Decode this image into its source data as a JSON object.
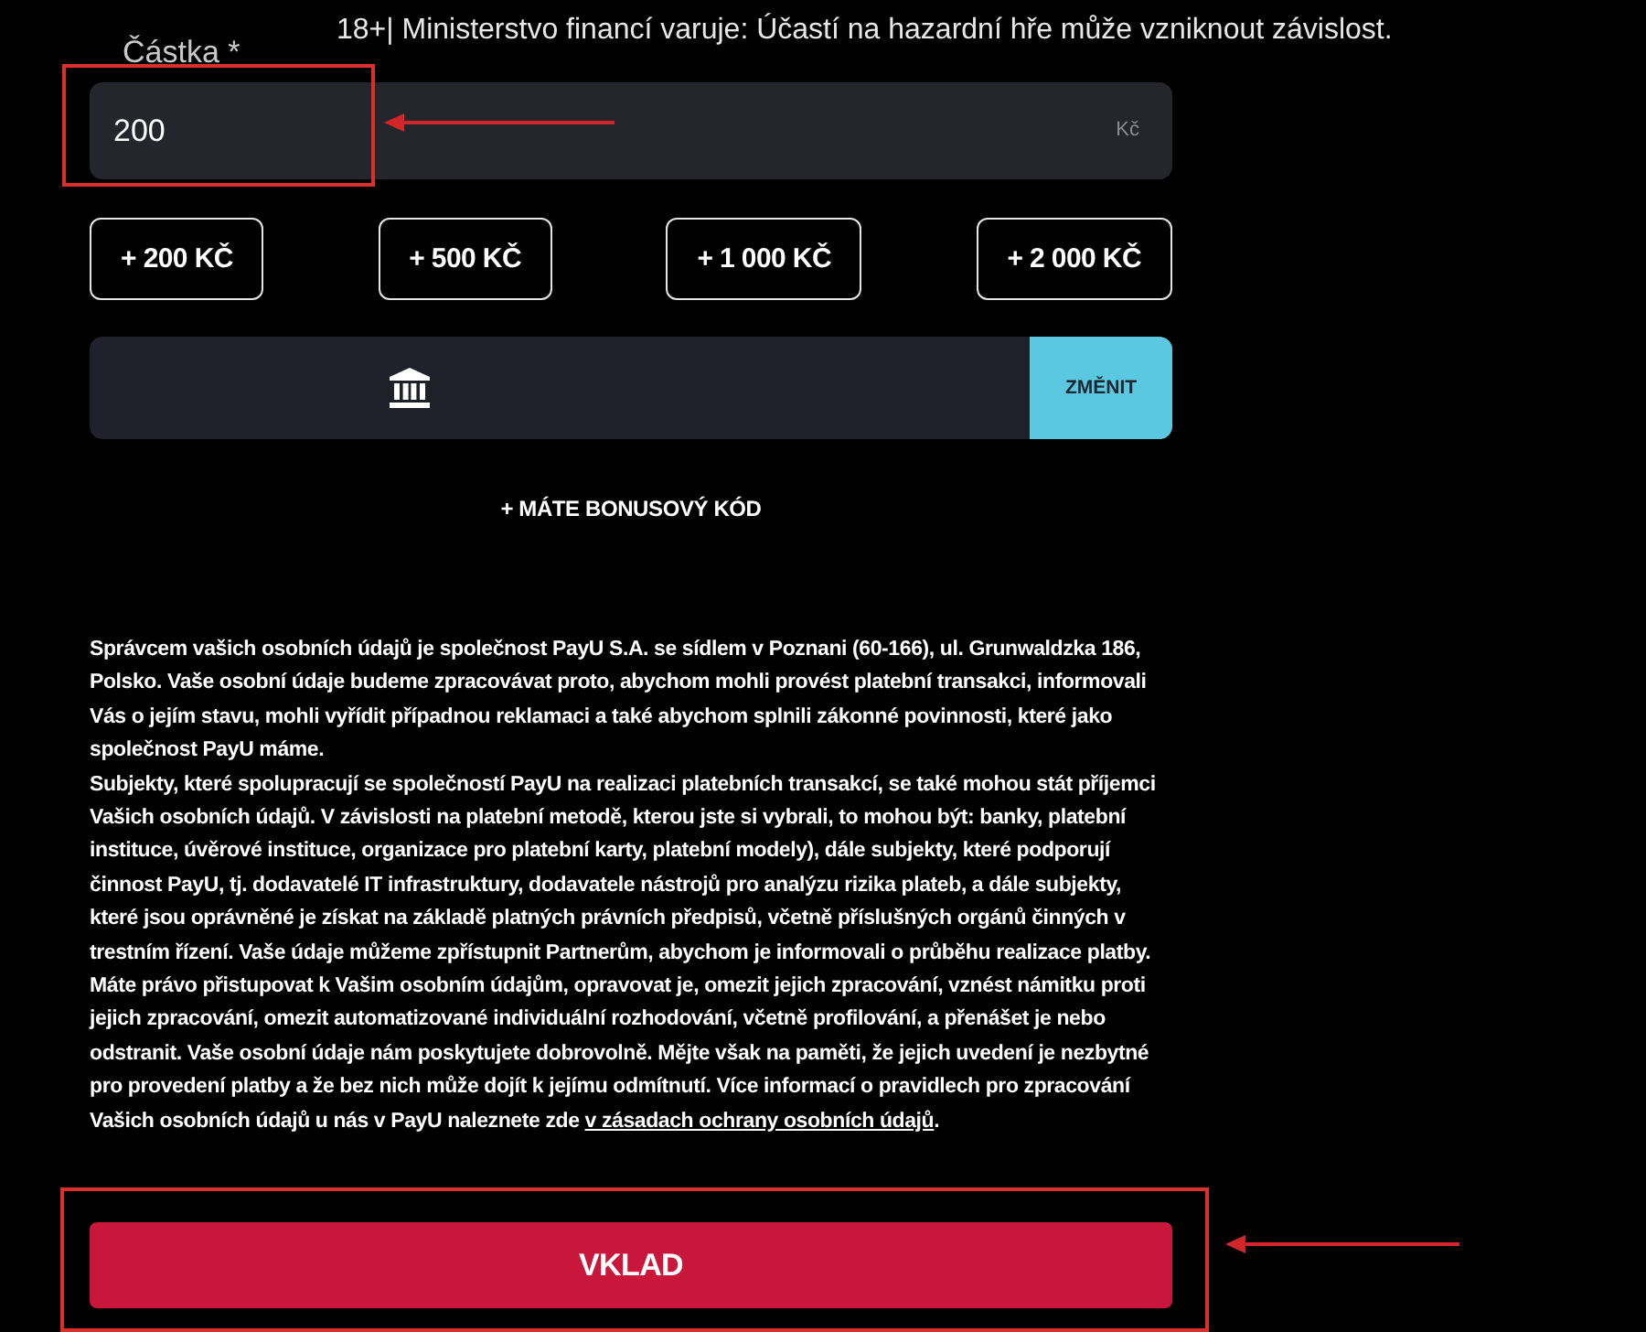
{
  "warning_banner": "18+| Ministerstvo financí varuje: Účastí na hazardní hře může vzniknout závislost.",
  "amount": {
    "label": "Částka *",
    "value": "200",
    "currency": "Kč"
  },
  "quick_amounts": [
    "+ 200 KČ",
    "+ 500 KČ",
    "+ 1 000 KČ",
    "+ 2 000 KČ"
  ],
  "payment_method": {
    "change_button": "ZMĚNIT"
  },
  "bonus_code_link": "+ MÁTE BONUSOVÝ KÓD",
  "privacy_notice": {
    "paragraphs": [
      {
        "text": "Správcem vašich osobních údajů je společnost PayU S.A. se sídlem v Poznani (60-166), ul. Grunwaldzka 186, Polsko. Vaše osobní údaje budeme zpracovávat proto, abychom mohli provést platební transakci, informovali Vás o jejím stavu, mohli vyřídit případnou reklamaci a také abychom splnili zákonné povinnosti, které jako společnost PayU máme."
      },
      {
        "text": "Subjekty, které spolupracují se společností PayU na realizaci platebních transakcí, se také mohou stát příjemci Vašich osobních údajů. V závislosti na platební metodě, kterou jste si vybrali, to mohou být: banky, platební instituce, úvěrové instituce, organizace pro platební karty, platební modely), dále subjekty, které podporují činnost PayU, tj. dodavatelé IT infrastruktury, dodavatele nástrojů pro analýzu rizika plateb, a dále subjekty, které jsou oprávněné je získat na základě platných právních předpisů, včetně příslušných orgánů činných v trestním řízení. Vaše údaje můžeme zpřístupnit Partnerům, abychom je informovali o průběhu realizace platby."
      },
      {
        "text": "Máte právo přistupovat k Vašim osobním údajům, opravovat je, omezit jejich zpracování, vznést námitku proti jejich zpracování, omezit automatizované individuální rozhodování, včetně profilování, a přenášet je nebo odstranit. Vaše osobní údaje nám poskytujete dobrovolně. Mějte však na paměti, že jejich uvedení je nezbytné pro provedení platby a že bez nich může dojít k jejímu odmítnutí. Více informací o pravidlech pro zpracování Vašich osobních údajů u nás v PayU naleznete zde ",
        "link": "v zásadach ochrany osobních údajů",
        "after": "."
      }
    ]
  },
  "submit_button": "VKLAD"
}
